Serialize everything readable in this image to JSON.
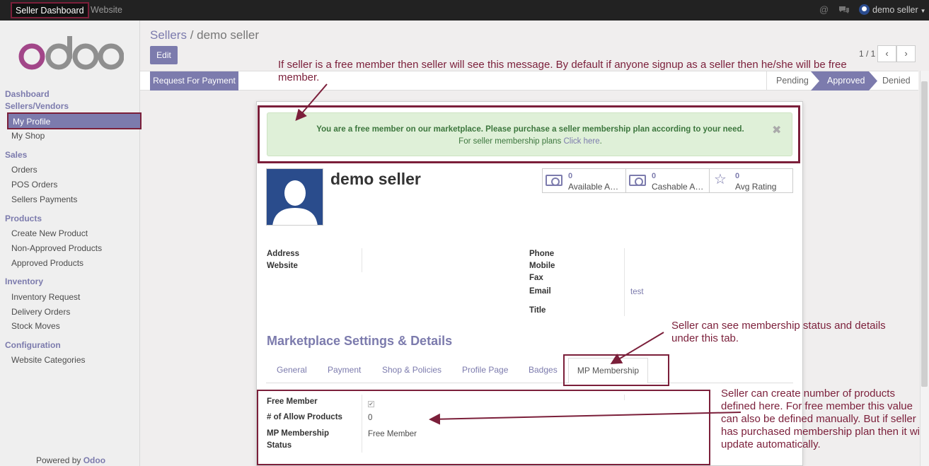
{
  "topbar": {
    "menu_active": "Seller Dashboard",
    "menu_website": "Website",
    "user_name": "demo seller"
  },
  "sidebar": {
    "logo_text": "odoo",
    "sections": {
      "dashboard": "Dashboard",
      "sellers": "Sellers/Vendors",
      "sales": "Sales",
      "products": "Products",
      "inventory": "Inventory",
      "configuration": "Configuration"
    },
    "items": {
      "my_profile": "My Profile",
      "my_shop": "My Shop",
      "orders": "Orders",
      "pos_orders": "POS Orders",
      "sellers_payments": "Sellers Payments",
      "create_new_product": "Create New Product",
      "non_approved_products": "Non-Approved Products",
      "approved_products": "Approved Products",
      "inventory_request": "Inventory Request",
      "delivery_orders": "Delivery Orders",
      "stock_moves": "Stock Moves",
      "website_categories": "Website Categories"
    },
    "powered_by": "Powered by",
    "powered_brand": "Odoo"
  },
  "header": {
    "breadcrumb_parent": "Sellers",
    "breadcrumb_sep": "/",
    "breadcrumb_current": "demo seller",
    "edit_label": "Edit",
    "pager": "1 / 1",
    "request_payment": "Request For Payment",
    "stages": [
      "Pending",
      "Approved",
      "Denied"
    ],
    "active_stage": "Approved"
  },
  "alert": {
    "title": "You are a free member on our marketplace. Please purchase a seller membership plan according to your need.",
    "sub_prefix": "For seller membership plans",
    "sub_link": "Click here",
    "sub_suffix": "."
  },
  "profile": {
    "name": "demo seller",
    "stats": [
      {
        "value": "0",
        "label": "Available Amount",
        "icon": "money-icon"
      },
      {
        "value": "0",
        "label": "Cashable Amount",
        "icon": "money-icon"
      },
      {
        "value": "0",
        "label": "Avg Rating",
        "icon": "star-icon"
      }
    ],
    "fields_left": {
      "address": "Address",
      "website": "Website"
    },
    "fields_right": {
      "phone": "Phone",
      "mobile": "Mobile",
      "fax": "Fax",
      "email": "Email",
      "email_value": "test",
      "title": "Title"
    }
  },
  "marketplace": {
    "section_title": "Marketplace Settings & Details",
    "tabs": [
      "General",
      "Payment",
      "Shop & Policies",
      "Profile Page",
      "Badges",
      "MP Membership"
    ],
    "active_tab": "MP Membership",
    "fields": {
      "free_member": "Free Member",
      "free_member_checked": true,
      "allow_products": "# of Allow Products",
      "allow_products_value": "0",
      "membership_status_1": "MP Membership",
      "membership_status_2": "Status",
      "membership_status_value": "Free Member"
    }
  },
  "annotations": {
    "note_alert": "If seller is a free member then seller will see this message. By default if anyone signup as a seller then he/she will be free member.",
    "note_tab": "Seller can see membership status and details under this tab.",
    "note_products": "Seller can create number of products defined here. For free member this value can also be defined manually. But if seller has purchased membership plan then it will update automatically.",
    "color": "#7b1f3a"
  },
  "colors": {
    "accent": "#7c7bad",
    "topbar": "#222222",
    "alert_bg": "#dff0d8",
    "alert_text": "#3c763d"
  }
}
